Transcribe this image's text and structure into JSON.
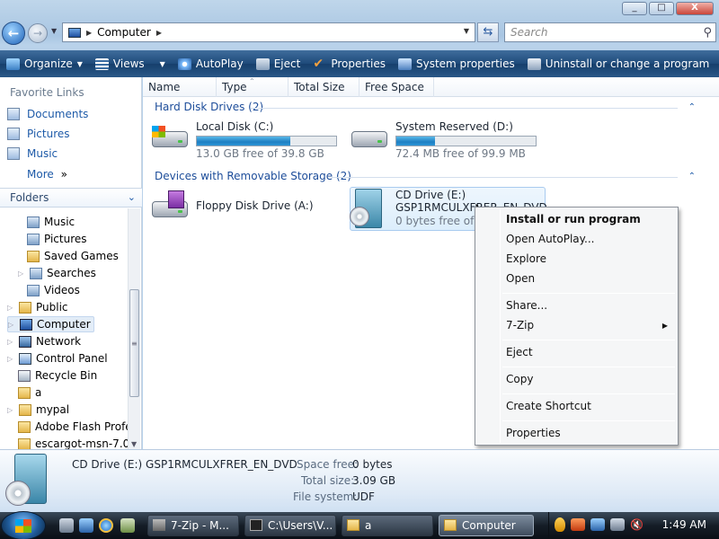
{
  "window": {
    "minimize": "_",
    "maximize": "□",
    "close": "X"
  },
  "nav": {
    "back": "←",
    "forward": "→",
    "address": "Computer",
    "search_placeholder": "Search"
  },
  "toolbar": {
    "organize": "Organize",
    "views": "Views",
    "autoplay": "AutoPlay",
    "eject": "Eject",
    "properties": "Properties",
    "system_properties": "System properties",
    "uninstall": "Uninstall or change a program",
    "more": "»"
  },
  "sidebar": {
    "favorite_title": "Favorite Links",
    "favorites": [
      "Documents",
      "Pictures",
      "Music"
    ],
    "more": "More",
    "more_chev": "»",
    "folders_title": "Folders",
    "tree": [
      "Music",
      "Pictures",
      "Saved Games",
      "Searches",
      "Videos",
      "Public",
      "Computer",
      "Network",
      "Control Panel",
      "Recycle Bin",
      "a",
      "mypal",
      "Adobe Flash Profe",
      "escargot-msn-7.0."
    ]
  },
  "columns": [
    "Name",
    "Type",
    "Total Size",
    "Free Space"
  ],
  "groups": {
    "hdd": "Hard Disk Drives (2)",
    "removable": "Devices with Removable Storage (2)"
  },
  "drives": {
    "c": {
      "name": "Local Disk (C:)",
      "free": "13.0 GB free of 39.8 GB",
      "used_fraction": 0.67
    },
    "d": {
      "name": "System Reserved (D:)",
      "free": "72.4 MB free of 99.9 MB",
      "used_fraction": 0.28
    },
    "a": {
      "name": "Floppy Disk Drive (A:)"
    },
    "e": {
      "name": "CD Drive (E:)",
      "label": "GSP1RMCULXFRER_EN_DVD",
      "free": "0 bytes free of 3"
    }
  },
  "context_menu": {
    "install": "Install or run program",
    "open_autoplay": "Open AutoPlay...",
    "explore": "Explore",
    "open": "Open",
    "share": "Share...",
    "zip": "7-Zip",
    "eject": "Eject",
    "copy": "Copy",
    "create_shortcut": "Create Shortcut",
    "properties": "Properties"
  },
  "details": {
    "title": "CD Drive (E:) GSP1RMCULXFRER_EN_DVD",
    "space_free_label": "Space free:",
    "space_free": "0 bytes",
    "total_size_label": "Total size:",
    "total_size": "3.09 GB",
    "fs_label": "File system:",
    "fs": "UDF"
  },
  "taskbar": {
    "items": [
      "7-Zip - M...",
      "C:\\Users\\V...",
      "a",
      "Computer"
    ],
    "clock": "1:49 AM"
  }
}
